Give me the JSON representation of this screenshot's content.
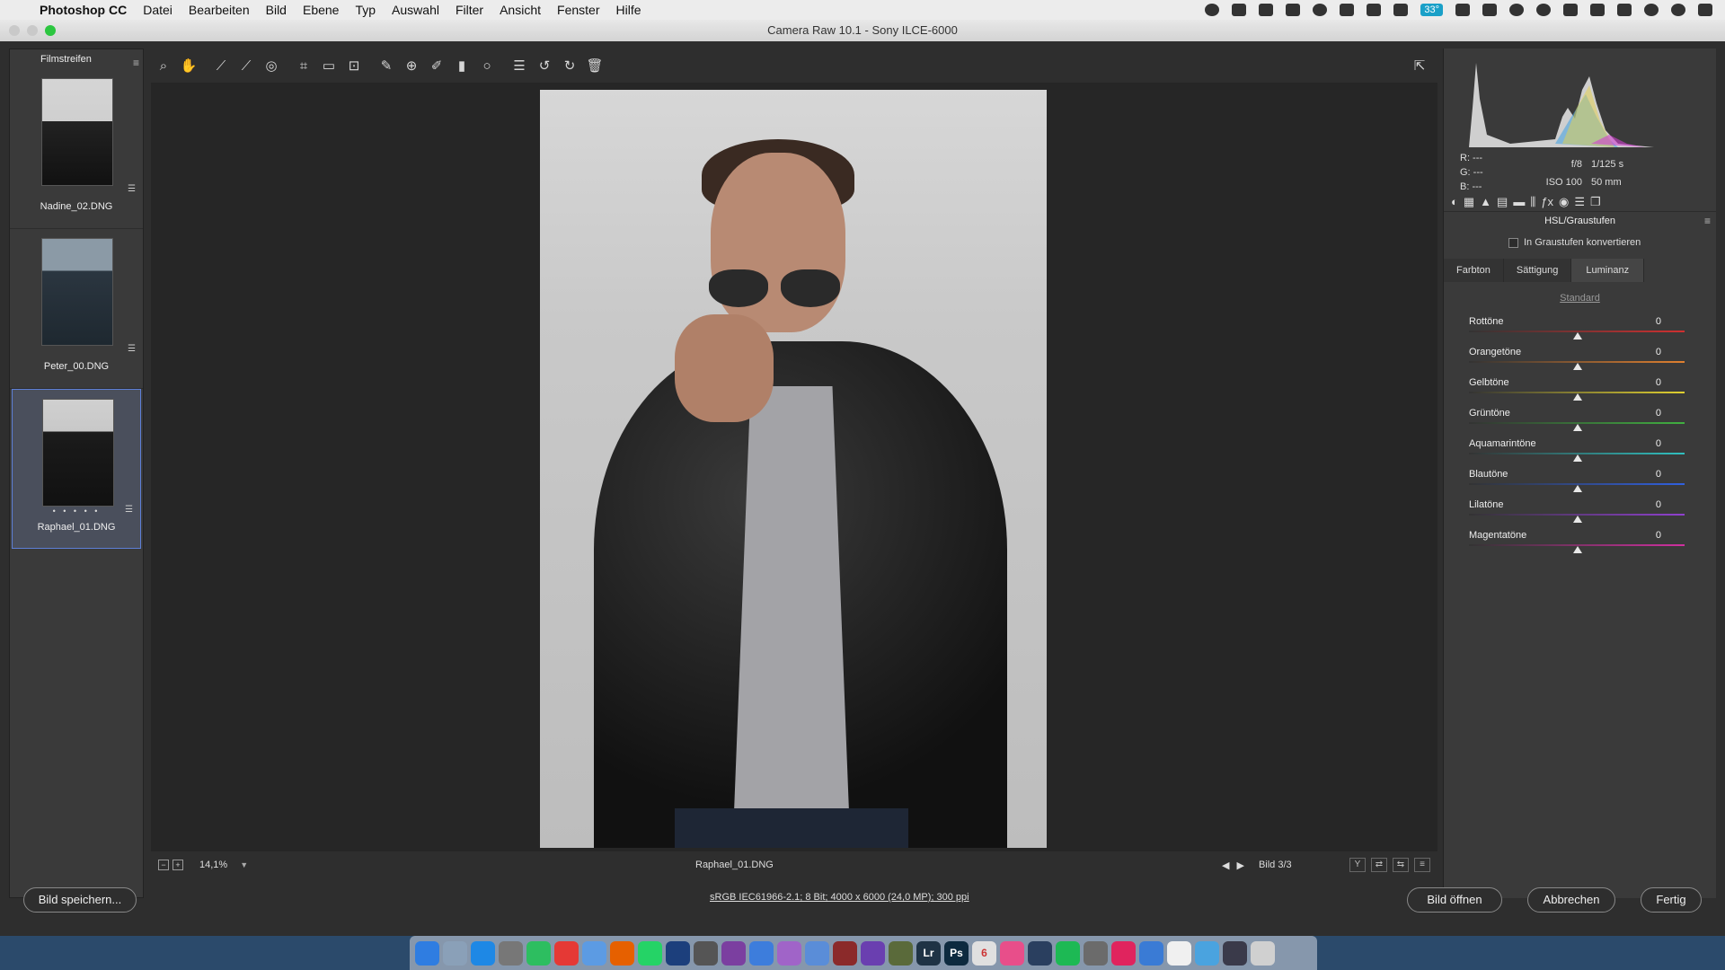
{
  "menubar": {
    "app_name": "Photoshop CC",
    "items": [
      "Datei",
      "Bearbeiten",
      "Bild",
      "Ebene",
      "Typ",
      "Auswahl",
      "Filter",
      "Ansicht",
      "Fenster",
      "Hilfe"
    ],
    "battery_label": "33°"
  },
  "window": {
    "title": "Camera Raw 10.1  -  Sony ILCE-6000"
  },
  "filmstrip": {
    "header": "Filmstreifen",
    "items": [
      {
        "name": "Nadine_02.DNG",
        "selected": false
      },
      {
        "name": "Peter_00.DNG",
        "selected": false
      },
      {
        "name": "Raphael_01.DNG",
        "selected": true,
        "rating_dots": "• • • • •"
      }
    ]
  },
  "toolbar": {
    "tools": [
      "zoom-icon",
      "hand-icon",
      "white-balance-icon",
      "color-sampler-icon",
      "target-adjustment-icon",
      "crop-icon",
      "straighten-icon",
      "transform-icon",
      "spot-removal-icon",
      "red-eye-icon",
      "adjustment-brush-icon",
      "graduated-filter-icon",
      "radial-filter-icon",
      "preferences-icon",
      "rotate-left-icon",
      "rotate-right-icon",
      "trash-icon"
    ]
  },
  "canvas_footer": {
    "zoom": "14,1%",
    "file_name": "Raphael_01.DNG",
    "image_index": "Bild 3/3"
  },
  "histogram": {
    "r": "R:   ---",
    "g": "G:   ---",
    "b": "B:   ---",
    "aperture": "f/8",
    "shutter": "1/125 s",
    "iso": "ISO 100",
    "focal": "50 mm"
  },
  "panel": {
    "title": "HSL/Graustufen",
    "grayscale_label": "In Graustufen konvertieren",
    "subtabs": [
      "Farbton",
      "Sättigung",
      "Luminanz"
    ],
    "active_subtab": "Luminanz",
    "standard_label": "Standard",
    "sliders": [
      {
        "label": "Rottöne",
        "value": "0"
      },
      {
        "label": "Orangetöne",
        "value": "0"
      },
      {
        "label": "Gelbtöne",
        "value": "0"
      },
      {
        "label": "Grüntöne",
        "value": "0"
      },
      {
        "label": "Aquamarintöne",
        "value": "0"
      },
      {
        "label": "Blautöne",
        "value": "0"
      },
      {
        "label": "Lilatöne",
        "value": "0"
      },
      {
        "label": "Magentatöne",
        "value": "0"
      }
    ]
  },
  "bottom": {
    "save_label": "Bild speichern...",
    "workflow_info": "sRGB IEC61966-2.1; 8 Bit; 4000 x 6000 (24,0 MP); 300 ppi",
    "open_label": "Bild öffnen",
    "cancel_label": "Abbrechen",
    "done_label": "Fertig"
  },
  "dock": {
    "items": [
      {
        "name": "finder-icon",
        "color": "#2f7de1",
        "glyph": ""
      },
      {
        "name": "launchpad-icon",
        "color": "#8aa0b8",
        "glyph": ""
      },
      {
        "name": "safari-icon",
        "color": "#1e88e5",
        "glyph": ""
      },
      {
        "name": "rocket-icon",
        "color": "#777",
        "glyph": ""
      },
      {
        "name": "evernote-icon",
        "color": "#2dbe60",
        "glyph": ""
      },
      {
        "name": "bookmark-icon",
        "color": "#e53935",
        "glyph": ""
      },
      {
        "name": "mail-icon",
        "color": "#5c9be3",
        "glyph": ""
      },
      {
        "name": "firefox-icon",
        "color": "#e66000",
        "glyph": ""
      },
      {
        "name": "whatsapp-icon",
        "color": "#25d366",
        "glyph": ""
      },
      {
        "name": "globe-icon",
        "color": "#1c3f7c",
        "glyph": ""
      },
      {
        "name": "camera-icon",
        "color": "#555",
        "glyph": ""
      },
      {
        "name": "music-app-icon",
        "color": "#7b3fa0",
        "glyph": ""
      },
      {
        "name": "info-icon",
        "color": "#3d7ddc",
        "glyph": ""
      },
      {
        "name": "affinity-icon",
        "color": "#a064c8",
        "glyph": ""
      },
      {
        "name": "mountain-icon",
        "color": "#5a8dd8",
        "glyph": ""
      },
      {
        "name": "book-icon",
        "color": "#8b2a2a",
        "glyph": ""
      },
      {
        "name": "affinity-designer-icon",
        "color": "#6a3fb0",
        "glyph": ""
      },
      {
        "name": "utility-icon",
        "color": "#5a6a3a",
        "glyph": ""
      },
      {
        "name": "lightroom-icon",
        "color": "#1f3345",
        "glyph": "Lr"
      },
      {
        "name": "photoshop-icon",
        "color": "#0d2a3f",
        "glyph": "Ps"
      },
      {
        "name": "calendar-icon",
        "color": "#e0e0e0",
        "glyph": "6"
      },
      {
        "name": "itunes-icon",
        "color": "#e84e8a",
        "glyph": ""
      },
      {
        "name": "music-label-icon",
        "color": "#2a3f5f",
        "glyph": ""
      },
      {
        "name": "spotify-icon",
        "color": "#1db954",
        "glyph": ""
      },
      {
        "name": "system-preferences-icon",
        "color": "#6b6b6b",
        "glyph": ""
      },
      {
        "name": "speech-icon",
        "color": "#e0245e",
        "glyph": ""
      },
      {
        "name": "search-app-icon",
        "color": "#3a7bd5",
        "glyph": ""
      },
      {
        "name": "document-icon",
        "color": "#f0f0f0",
        "glyph": ""
      },
      {
        "name": "folder-icon",
        "color": "#4aa3df",
        "glyph": ""
      },
      {
        "name": "screen-icon",
        "color": "#3a3a4a",
        "glyph": ""
      },
      {
        "name": "trash-dock-icon",
        "color": "#d0d0d0",
        "glyph": ""
      }
    ]
  },
  "colors": {
    "accent_selected": "#5d7fd6",
    "panel_bg": "#3a3a3a",
    "canvas_bg": "#262626"
  }
}
